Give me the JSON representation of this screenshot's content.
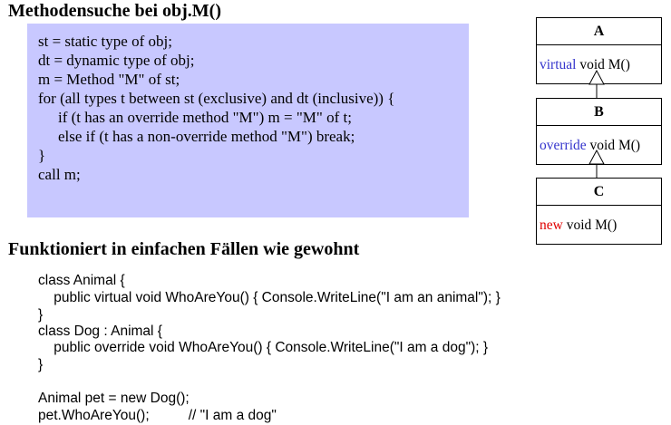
{
  "title1": "Methodensuche bei obj.M()",
  "algorithm": [
    "st = static type of obj;",
    "dt = dynamic type of obj;",
    "m = Method \"M\" of st;",
    "for (all types t between st (exclusive) and dt (inclusive)) {",
    "if (t has an override method \"M\") m = \"M\" of t;",
    "else if (t has a non-override method \"M\") break;",
    "}",
    "call m;"
  ],
  "uml": [
    {
      "name": "A",
      "keyword": "virtual",
      "signature": " void M()",
      "keyword_color": "#3333cc"
    },
    {
      "name": "B",
      "keyword": "override",
      "signature": " void M()",
      "keyword_color": "#3333cc"
    },
    {
      "name": "C",
      "keyword": "new",
      "signature": " void M()",
      "keyword_color": "#e00000"
    }
  ],
  "title2": "Funktioniert in einfachen Fällen wie gewohnt",
  "code": [
    "class Animal {",
    "    public virtual void WhoAreYou() { Console.WriteLine(\"I am an animal\"); }",
    "}",
    "class Dog : Animal {",
    "    public override void WhoAreYou() { Console.WriteLine(\"I am a dog\"); }",
    "}",
    "",
    "Animal pet = new Dog();",
    "pet.WhoAreYou();          // \"I am a dog\""
  ]
}
